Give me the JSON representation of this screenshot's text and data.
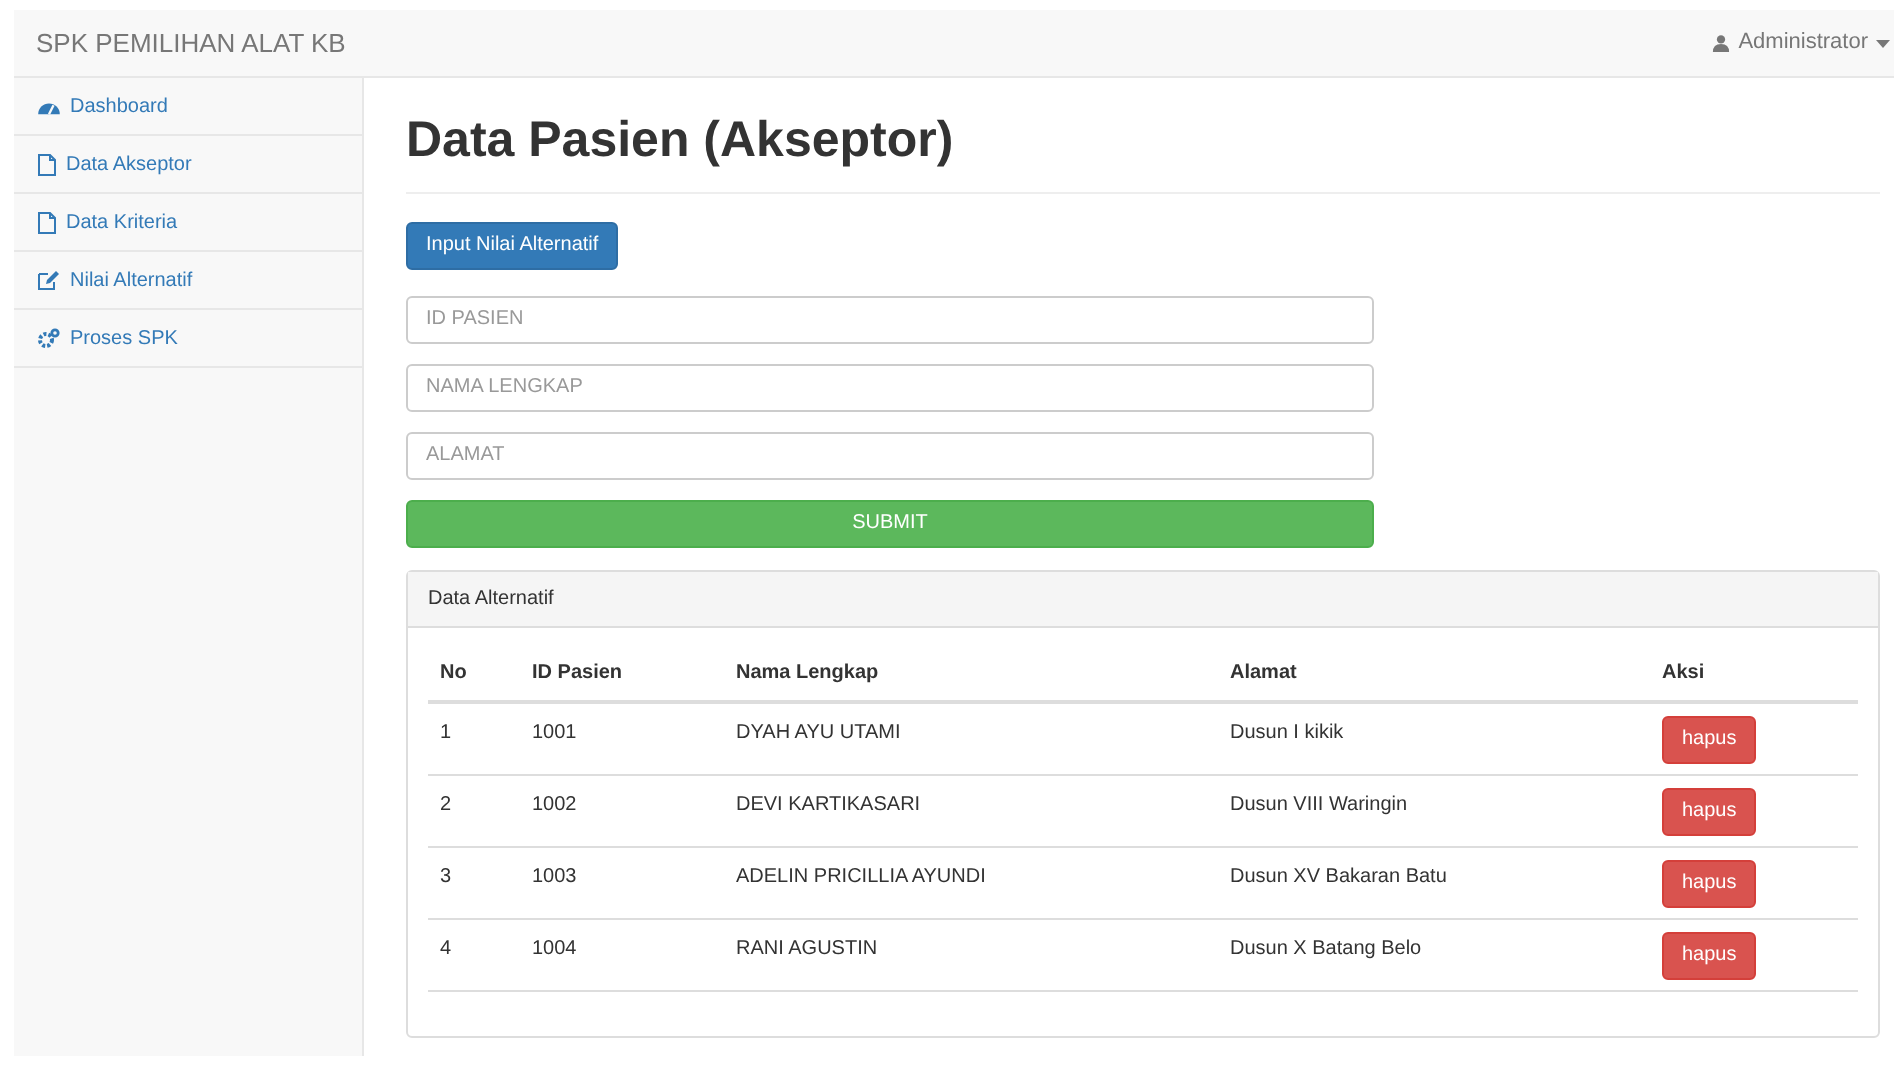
{
  "navbar": {
    "brand": "SPK PEMILIHAN ALAT KB",
    "user": "Administrator"
  },
  "sidebar": {
    "items": [
      {
        "label": "Dashboard"
      },
      {
        "label": "Data Akseptor"
      },
      {
        "label": "Data Kriteria"
      },
      {
        "label": "Nilai Alternatif"
      },
      {
        "label": "Proses SPK"
      }
    ]
  },
  "page": {
    "title": "Data Pasien (Akseptor)",
    "action_button": "Input Nilai Alternatif",
    "form": {
      "fields": [
        {
          "placeholder": "ID PASIEN"
        },
        {
          "placeholder": "NAMA LENGKAP"
        },
        {
          "placeholder": "ALAMAT"
        }
      ],
      "submit": "SUBMIT"
    }
  },
  "panel": {
    "heading": "Data Alternatif",
    "table": {
      "columns": [
        "No",
        "ID Pasien",
        "Nama Lengkap",
        "Alamat",
        "Aksi"
      ],
      "rows": [
        {
          "cells": [
            "1",
            "1001",
            "DYAH AYU UTAMI",
            "Dusun I kikik"
          ],
          "action": "hapus"
        },
        {
          "cells": [
            "2",
            "1002",
            "DEVI KARTIKASARI",
            "Dusun VIII Waringin"
          ],
          "action": "hapus"
        },
        {
          "cells": [
            "3",
            "1003",
            "ADELIN PRICILLIA AYUNDI",
            "Dusun XV Bakaran Batu"
          ],
          "action": "hapus"
        },
        {
          "cells": [
            "4",
            "1004",
            "RANI AGUSTIN",
            "Dusun X Batang Belo"
          ],
          "action": "hapus"
        }
      ]
    }
  }
}
